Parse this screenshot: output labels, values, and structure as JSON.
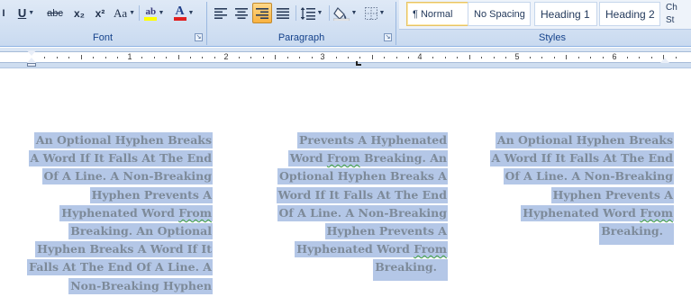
{
  "ribbon": {
    "font_group": {
      "label": "Font",
      "buttons": {
        "underline": "U",
        "strikethrough": "abc",
        "subscript": "x₂",
        "superscript": "x²",
        "change_case": "Aa",
        "font_color": "A"
      }
    },
    "paragraph_group": {
      "label": "Paragraph"
    },
    "styles_group": {
      "label": "Styles",
      "styles": [
        "¶ Normal",
        "No Spacing",
        "Heading 1",
        "Heading 2"
      ],
      "change_styles": [
        "Ch",
        "St"
      ]
    }
  },
  "ruler": {
    "numbers": [
      "1",
      "2",
      "3",
      "4",
      "5",
      "6"
    ]
  },
  "colors": {
    "selection": "#b4c7e7",
    "text": "#7d8a99",
    "spell_underline": "#3d9e3d"
  },
  "document": {
    "column1": [
      "An Optional Hyphen Breaks",
      "A Word If It Falls At The End",
      "Of A Line. A Non-Breaking",
      "Hyphen Prevents A",
      [
        "Hyphenated Word ",
        "From"
      ],
      "Breaking.  An Optional",
      "Hyphen Breaks A Word If It",
      "Falls At The End Of A Line. A",
      "Non-Breaking Hyphen"
    ],
    "column2": [
      "Prevents A Hyphenated",
      [
        "Word ",
        "From",
        " Breaking.   An"
      ],
      "Optional Hyphen Breaks A",
      "Word If It Falls At The End",
      "Of A Line. A Non-Breaking",
      "Hyphen Prevents A",
      [
        "Hyphenated Word ",
        "From"
      ],
      "Breaking."
    ],
    "column3": [
      "An Optional Hyphen Breaks",
      "A Word If It Falls At The End",
      "Of A Line. A Non-Breaking",
      "Hyphen Prevents A",
      [
        "Hyphenated Word ",
        "From"
      ],
      "Breaking."
    ]
  }
}
